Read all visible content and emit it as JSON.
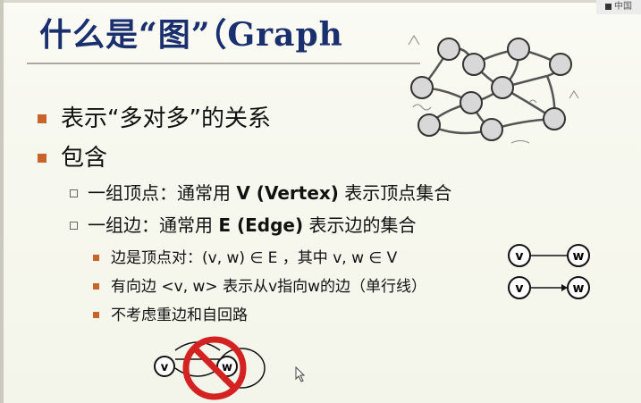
{
  "slide": {
    "title": "什么是“图”（Graph",
    "corner_badge": "中国",
    "bullets": [
      {
        "text": "表示“多对多”的关系"
      },
      {
        "text": "包含"
      }
    ],
    "sub_bullets": [
      {
        "prefix": "一组顶点：通常用 ",
        "bold": "V (Vertex)",
        "suffix": " 表示顶点集合"
      },
      {
        "prefix": "一组边：通常用 ",
        "bold": "E (Edge)",
        "suffix": " 表示边的集合"
      }
    ],
    "sub_sub_bullets": [
      {
        "text": "边是顶点对：(v, w) ∈ E ，其中 v, w ∈ V"
      },
      {
        "text": "有向边 <v, w> 表示从v指向w的边（单行线）"
      },
      {
        "text": "不考虑重边和自回路"
      }
    ],
    "edge_diagram": {
      "left_node": "v",
      "right_node": "w"
    },
    "directed_diagram": {
      "left_node": "v",
      "right_node": "w"
    },
    "forbidden_diagram": {
      "left_node": "v",
      "right_node": "w"
    }
  },
  "colors": {
    "title": "#1a2f6e",
    "bullet": "#c8642a",
    "forbidden": "#d42222"
  }
}
